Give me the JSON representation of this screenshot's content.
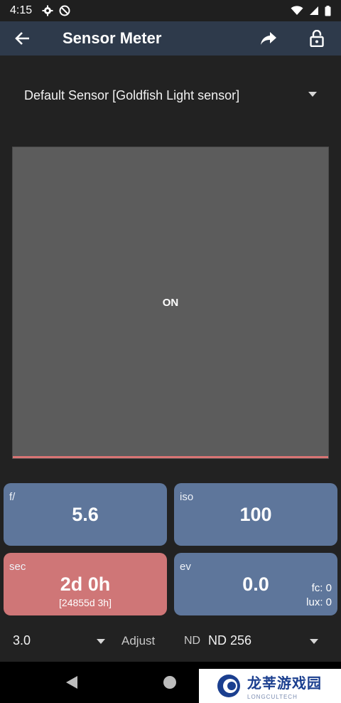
{
  "status_bar": {
    "time": "4:15"
  },
  "app_bar": {
    "title": "Sensor Meter"
  },
  "sensor": {
    "selected": "Default Sensor [Goldfish Light sensor]"
  },
  "meter": {
    "status": "ON"
  },
  "tiles": {
    "aperture": {
      "label": "f/",
      "value": "5.6"
    },
    "iso": {
      "label": "iso",
      "value": "100"
    },
    "shutter": {
      "label": "sec",
      "value": "2d 0h",
      "sub": "[24855d 3h]"
    },
    "ev": {
      "label": "ev",
      "value": "0.0",
      "fc": "fc: 0",
      "lux": "lux: 0"
    }
  },
  "controls": {
    "stop_value": "3.0",
    "adjust_label": "Adjust",
    "nd_tag": "ND",
    "nd_value": "ND 256"
  },
  "watermark": {
    "main": "龙莘游戏园",
    "sub": "LONGCULTECH"
  },
  "colors": {
    "app_bar": "#2e3a4b",
    "tile_blue": "#5e769b",
    "tile_red": "#cf7677",
    "meter_bg": "#5c5c5c",
    "meter_bar": "#d97575"
  }
}
